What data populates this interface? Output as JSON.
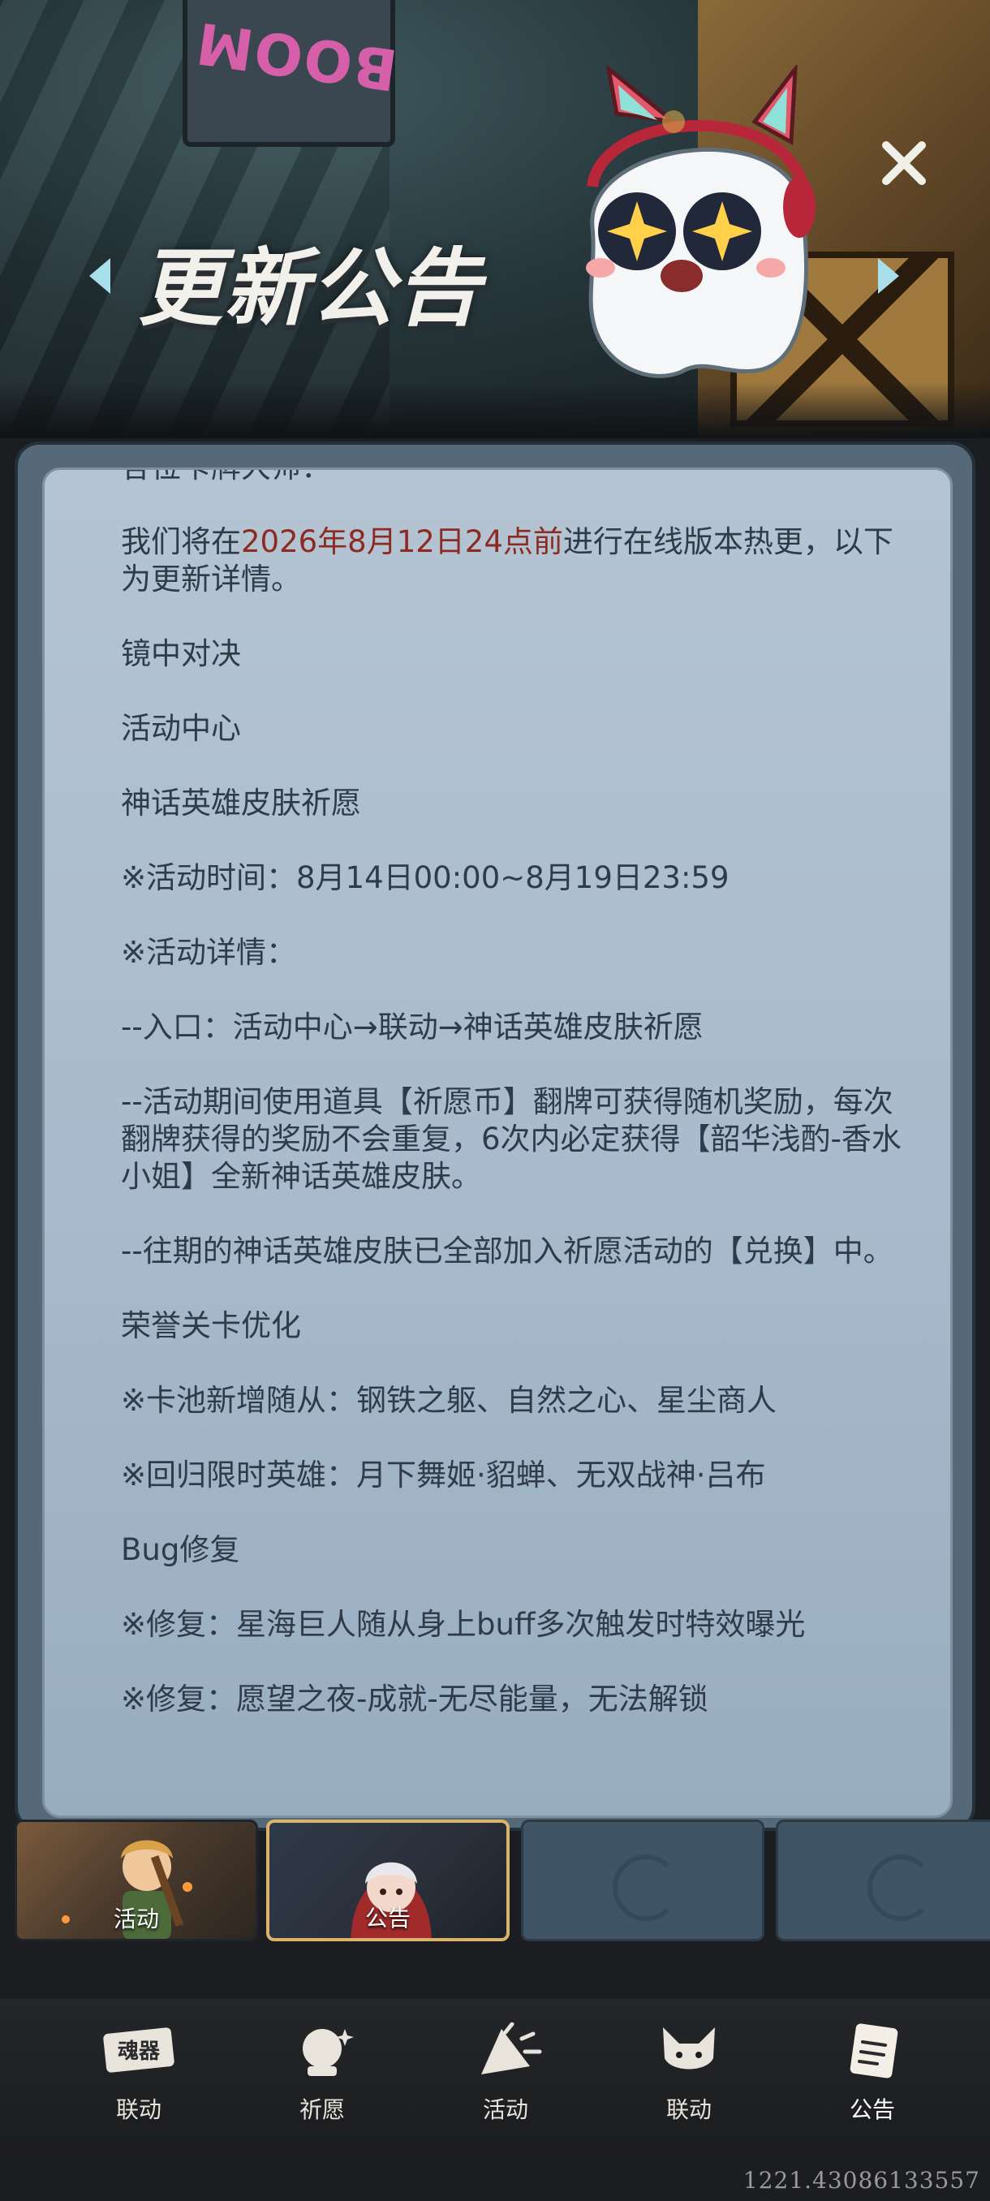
{
  "header": {
    "sign_text": "BOOM",
    "title": "更新公告",
    "close_icon": "close-icon"
  },
  "announcement": {
    "cut_line": "各位卡牌大师：",
    "intro_prefix": "我们将在",
    "intro_highlight": "2026年8月12日24点前",
    "intro_suffix": "进行在线版本热更，以下为更新详情。",
    "section1": "镜中对决",
    "section2": "活动中心",
    "section3": "神话英雄皮肤祈愿",
    "time_line": "※活动时间：8月14日00:00~8月19日23:59",
    "details_label": "※活动详情：",
    "entry_line": "--入口：活动中心→联动→神话英雄皮肤祈愿",
    "usage_line": "--活动期间使用道具【祈愿币】翻牌可获得随机奖励，每次翻牌获得的奖励不会重复，6次内必定获得【韶华浅酌-香水小姐】全新神话英雄皮肤。",
    "past_line": "--往期的神话英雄皮肤已全部加入祈愿活动的【兑换】中。",
    "section4": "荣誉关卡优化",
    "pool_line": "※卡池新增随从：钢铁之躯、自然之心、星尘商人",
    "return_line": "※回归限时英雄：月下舞姬·貂蝉、无双战神·吕布",
    "section5": "Bug修复",
    "fix1": "※修复：星海巨人随从身上buff多次触发时特效曝光",
    "fix2": "※修复：愿望之夜-成就-无尽能量，无法解锁"
  },
  "tabs": [
    {
      "label": "活动",
      "active": false
    },
    {
      "label": "公告",
      "active": true
    },
    {
      "label": "",
      "active": false
    },
    {
      "label": "",
      "active": false
    }
  ],
  "bottom_nav": [
    {
      "label": "联动",
      "icon": "mask-icon",
      "sign_text": "魂器"
    },
    {
      "label": "祈愿",
      "icon": "crystal-ball-icon"
    },
    {
      "label": "活动",
      "icon": "party-horn-icon"
    },
    {
      "label": "联动",
      "icon": "fox-icon"
    },
    {
      "label": "公告",
      "icon": "notice-paper-icon"
    }
  ],
  "version": "1221.43086133557",
  "colors": {
    "highlight_red": "#8c2b22",
    "green_heading": "#325a34",
    "panel_bg": "#a8bacb",
    "text": "#2f3b49",
    "active_tab_border": "#d9b46a"
  }
}
